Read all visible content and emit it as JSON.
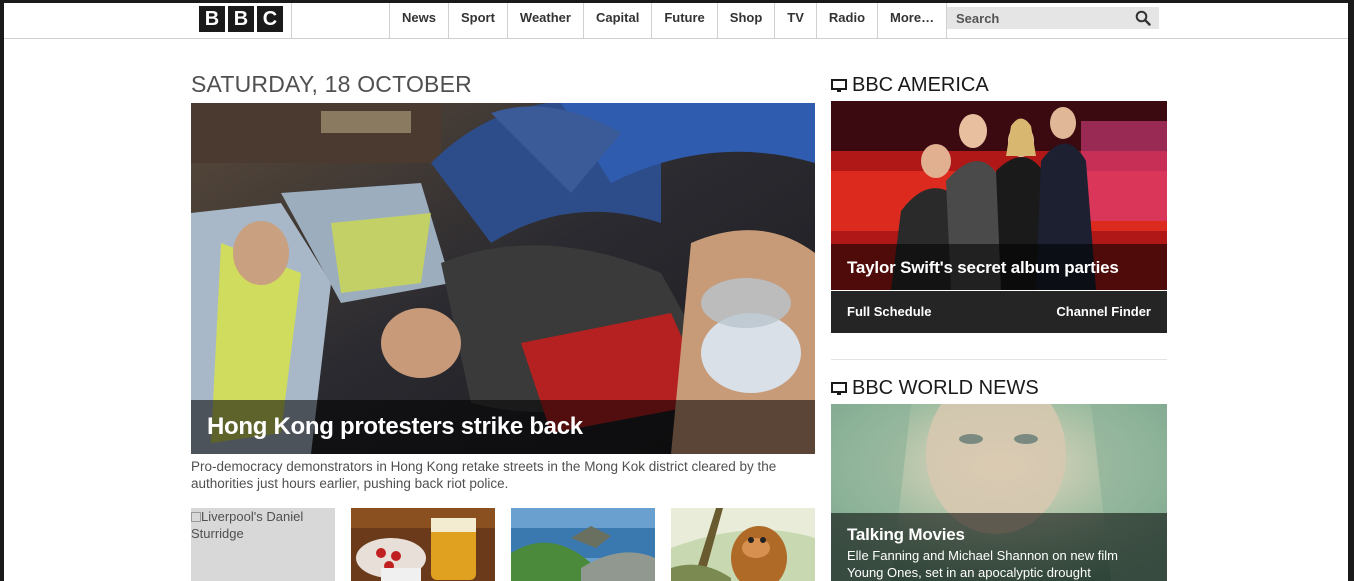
{
  "header": {
    "logo_letters": [
      "B",
      "B",
      "C"
    ],
    "nav_items": [
      "News",
      "Sport",
      "Weather",
      "Capital",
      "Future",
      "Shop",
      "TV",
      "Radio",
      "More…"
    ],
    "search": {
      "placeholder": "Search",
      "icon": "search-icon"
    }
  },
  "main": {
    "date": "SATURDAY, 18 OCTOBER",
    "hero": {
      "headline": "Hong Kong protesters strike back",
      "summary": "Pro-democracy demonstrators in Hong Kong retake streets in the Mong Kok district cleared by the authorities just hours earlier, pushing back riot police."
    },
    "thumbs": [
      {
        "alt": "Liverpool's Daniel Sturridge",
        "broken": true
      },
      {
        "alt": "",
        "broken": false
      },
      {
        "alt": "",
        "broken": false
      },
      {
        "alt": "",
        "broken": false
      }
    ]
  },
  "sidebar": {
    "america": {
      "heading": "BBC AMERICA",
      "icon": "tv-icon",
      "promo_title": "Taylor Swift's secret album parties",
      "links": [
        "Full Schedule",
        "Channel Finder"
      ]
    },
    "world_news": {
      "heading": "BBC WORLD NEWS",
      "icon": "tv-icon",
      "promo_title": "Talking Movies",
      "promo_sub": "Elle Fanning and Michael Shannon on new film Young Ones, set in an apocalyptic drought"
    }
  }
}
